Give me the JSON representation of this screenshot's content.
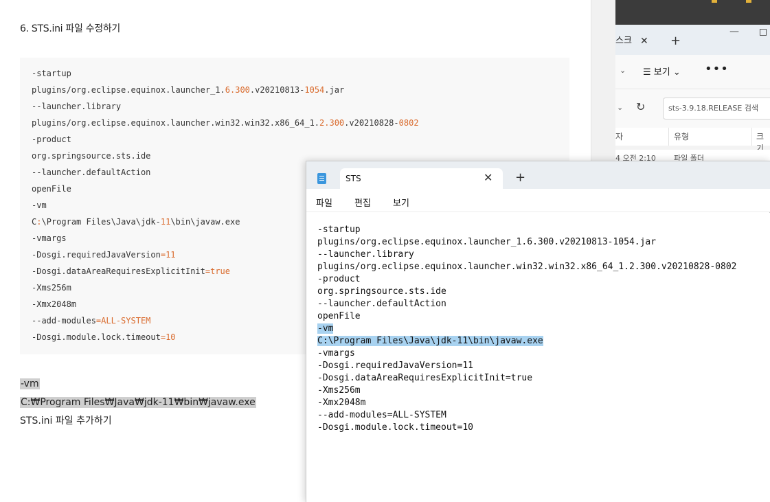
{
  "article": {
    "title": "6. STS.ini 파일 수정하기",
    "code_lines": [
      [
        {
          "t": "-startup",
          "c": ""
        }
      ],
      [
        {
          "t": "plugins/org.eclipse.equinox.launcher_1.",
          "c": ""
        },
        {
          "t": "6.300",
          "c": "num"
        },
        {
          "t": ".v20210813-",
          "c": ""
        },
        {
          "t": "1054",
          "c": "num"
        },
        {
          "t": ".jar",
          "c": ""
        }
      ],
      [
        {
          "t": "--launcher.library",
          "c": ""
        }
      ],
      [
        {
          "t": "plugins/org.eclipse.equinox.launcher.win32.win32.x86_64_1.",
          "c": ""
        },
        {
          "t": "2.300",
          "c": "num"
        },
        {
          "t": ".v20210828-",
          "c": ""
        },
        {
          "t": "0802",
          "c": "num"
        }
      ],
      [
        {
          "t": "-product",
          "c": ""
        }
      ],
      [
        {
          "t": "org.springsource.sts.ide",
          "c": ""
        }
      ],
      [
        {
          "t": "--launcher.defaultAction",
          "c": ""
        }
      ],
      [
        {
          "t": "openFile",
          "c": ""
        }
      ],
      [
        {
          "t": "-vm",
          "c": ""
        }
      ],
      [
        {
          "t": "C",
          "c": ""
        },
        {
          "t": ":",
          "c": "sym"
        },
        {
          "t": "\\Program Files\\Java\\jdk-",
          "c": ""
        },
        {
          "t": "11",
          "c": "num"
        },
        {
          "t": "\\bin\\javaw.exe",
          "c": ""
        }
      ],
      [
        {
          "t": "-vmargs",
          "c": ""
        }
      ],
      [
        {
          "t": "-Dosgi.requiredJavaVersion",
          "c": ""
        },
        {
          "t": "=11",
          "c": "num"
        }
      ],
      [
        {
          "t": "-Dosgi.dataAreaRequiresExplicitInit",
          "c": ""
        },
        {
          "t": "=true",
          "c": "val"
        }
      ],
      [
        {
          "t": "-Xms256m",
          "c": ""
        }
      ],
      [
        {
          "t": "-Xmx2048m",
          "c": ""
        }
      ],
      [
        {
          "t": "--add-modules",
          "c": ""
        },
        {
          "t": "=ALL-SYSTEM",
          "c": "val"
        }
      ],
      [
        {
          "t": "-Dosgi.module.lock.timeout",
          "c": ""
        },
        {
          "t": "=10",
          "c": "num"
        }
      ]
    ],
    "note_vm": "-vm",
    "note_path": "C:₩Program Files₩Java₩jdk-11₩bin₩javaw.exe",
    "note_add": "STS.ini 파일 추가하기"
  },
  "explorer": {
    "tab_label": "스크",
    "tab_close": "✕",
    "new_tab": "+",
    "minimize": "—",
    "view_label": "☰ 보기 ⌄",
    "more": "•••",
    "refresh": "↻",
    "search_placeholder": "sts-3.9.18.RELEASE 검색",
    "col_date": "자",
    "col_type": "유형",
    "col_size": "크기",
    "row_date": "4 오전 2:10",
    "row_type": "파일 폴더"
  },
  "notepad": {
    "tab_title": "STS",
    "tab_close": "✕",
    "new_tab": "+",
    "menu_file": "파일",
    "menu_edit": "편집",
    "menu_view": "보기",
    "lines": [
      "-startup",
      "plugins/org.eclipse.equinox.launcher_1.6.300.v20210813-1054.jar",
      "--launcher.library",
      "plugins/org.eclipse.equinox.launcher.win32.win32.x86_64_1.2.300.v20210828-0802",
      "-product",
      "org.springsource.sts.ide",
      "--launcher.defaultAction",
      "openFile",
      "-vm",
      "C:\\Program Files\\Java\\jdk-11\\bin\\javaw.exe",
      "-vmargs",
      "-Dosgi.requiredJavaVersion=11",
      "-Dosgi.dataAreaRequiresExplicitInit=true",
      "-Xms256m",
      "-Xmx2048m",
      "--add-modules=ALL-SYSTEM",
      "-Dosgi.module.lock.timeout=10"
    ],
    "selected_lines": [
      8,
      9
    ]
  },
  "colors": {
    "accent_orange": "#d96a2c",
    "selection_blue": "#a8d2f0",
    "highlight_gray": "#cfcfcf"
  }
}
